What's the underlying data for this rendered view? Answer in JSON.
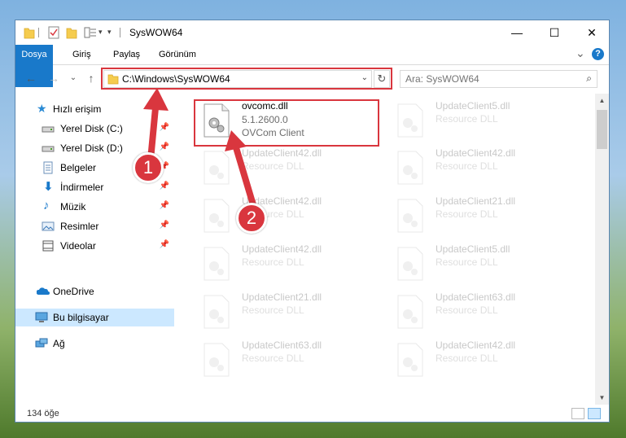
{
  "window": {
    "title": "SysWOW64",
    "controls": {
      "minimize": "—",
      "maximize": "☐",
      "close": "✕"
    }
  },
  "ribbon": {
    "tabs": [
      "Dosya",
      "Giriş",
      "Paylaş",
      "Görünüm"
    ],
    "collapse": "⌄",
    "help": "?"
  },
  "nav": {
    "back": "←",
    "forward": "→",
    "recent": "⌄",
    "up": "↑",
    "address": "C:\\Windows\\SysWOW64",
    "address_chevron": "⌄",
    "refresh": "↻",
    "search_placeholder": "Ara: SysWOW64",
    "search_icon": "⌕"
  },
  "sidebar": {
    "items": [
      {
        "label": "Hızlı erişim",
        "icon": "star-icon",
        "pinned": false
      },
      {
        "label": "Yerel Disk (C:)",
        "icon": "drive-icon",
        "pinned": true
      },
      {
        "label": "Yerel Disk (D:)",
        "icon": "drive-icon",
        "pinned": true
      },
      {
        "label": "Belgeler",
        "icon": "documents-icon",
        "pinned": true
      },
      {
        "label": "İndirmeler",
        "icon": "downloads-icon",
        "pinned": true
      },
      {
        "label": "Müzik",
        "icon": "music-icon",
        "pinned": true
      },
      {
        "label": "Resimler",
        "icon": "pictures-icon",
        "pinned": true
      },
      {
        "label": "Videolar",
        "icon": "videos-icon",
        "pinned": true
      },
      {
        "label": "OneDrive",
        "icon": "onedrive-icon",
        "pinned": false
      },
      {
        "label": "Bu bilgisayar",
        "icon": "computer-icon",
        "pinned": false,
        "selected": true
      },
      {
        "label": "Ağ",
        "icon": "network-icon",
        "pinned": false
      }
    ],
    "pin_glyph": "📌"
  },
  "files": {
    "highlighted": {
      "name": "ovcomc.dll",
      "version": "5.1.2600.0",
      "description": "OVCom Client"
    },
    "left_column": [
      {
        "name": "",
        "type": ""
      },
      {
        "name": "UpdateClient42.dll",
        "type": "Resource DLL"
      },
      {
        "name": "UpdateClient42.dll",
        "type": "Resource DLL"
      },
      {
        "name": "UpdateClient42.dll",
        "type": "Resource DLL"
      },
      {
        "name": "UpdateClient21.dll",
        "type": "Resource DLL"
      },
      {
        "name": "UpdateClient63.dll",
        "type": "Resource DLL"
      }
    ],
    "right_column": [
      {
        "name": "UpdateClient5.dll",
        "type": "Resource DLL"
      },
      {
        "name": "UpdateClient42.dll",
        "type": "Resource DLL"
      },
      {
        "name": "UpdateClient21.dll",
        "type": "Resource DLL"
      },
      {
        "name": "UpdateClient5.dll",
        "type": "Resource DLL"
      },
      {
        "name": "UpdateClient63.dll",
        "type": "Resource DLL"
      },
      {
        "name": "UpdateClient42.dll",
        "type": "Resource DLL"
      }
    ]
  },
  "status": {
    "count": "134 öğe"
  },
  "annotations": {
    "step1": "1",
    "step2": "2",
    "color": "#d9363e"
  }
}
